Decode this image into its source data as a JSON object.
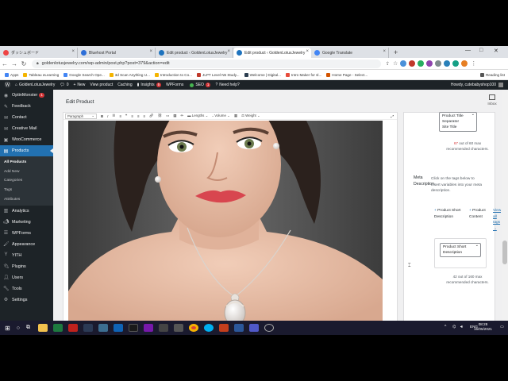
{
  "browser": {
    "tabs": [
      {
        "label": "ダッシュボード",
        "active": false
      },
      {
        "label": "Bluehost Portal",
        "active": false
      },
      {
        "label": "Edit product ‹ GoldenLotusJewelry",
        "active": false
      },
      {
        "label": "Edit product ‹ GoldenLotusJewelry",
        "active": true
      },
      {
        "label": "Google Translate",
        "active": false
      }
    ],
    "new_tab": "+",
    "url": "goldenlotusjewelry.com/wp-admin/post.php?post=379&action=edit",
    "bookmarks": [
      "Apps",
      "Tableau eLearning",
      "Google Search Ope...",
      "3d Scan Anything U...",
      "Introduction to Co...",
      "JLPT Level N5 Study...",
      "Welcome | Digital...",
      "Intro Maker for sl...",
      "Home Page - Select..."
    ],
    "reading_list": "Reading list"
  },
  "adminbar": {
    "site": "GoldenLotusJewelry",
    "comments": "0",
    "new": "New",
    "view": "View product",
    "caching": "Caching",
    "insights": "Insights",
    "insights_count": "5",
    "wpforms": "WPForms",
    "seo": "SEO",
    "seo_count": "1",
    "help": "Need help?",
    "howdy": "Howdy, cutebabyshop100"
  },
  "sidebar": {
    "items": [
      {
        "label": "OptinMonster",
        "badge": "1",
        "icon": "optinmonster-icon"
      },
      {
        "label": "Feedback",
        "icon": "feedback-icon"
      },
      {
        "label": "Contact",
        "icon": "contact-icon"
      },
      {
        "label": "Creative Mail",
        "icon": "mail-icon"
      },
      {
        "label": "WooCommerce",
        "icon": "woocommerce-icon"
      },
      {
        "label": "Products",
        "icon": "products-icon",
        "active": true
      }
    ],
    "submenu": [
      "All Products",
      "Add New",
      "Categories",
      "Tags",
      "Attributes"
    ],
    "items_after": [
      {
        "label": "Analytics",
        "icon": "analytics-icon"
      },
      {
        "label": "Marketing",
        "icon": "marketing-icon"
      },
      {
        "label": "WPForms",
        "icon": "wpforms-icon"
      },
      {
        "label": "Appearance",
        "icon": "appearance-icon"
      },
      {
        "label": "YITH",
        "icon": "yith-icon"
      },
      {
        "label": "Plugins",
        "icon": "plugins-icon"
      },
      {
        "label": "Users",
        "icon": "users-icon"
      },
      {
        "label": "Tools",
        "icon": "tools-icon"
      },
      {
        "label": "Settings",
        "icon": "settings-icon"
      }
    ]
  },
  "main": {
    "page_title": "Edit Product",
    "inbox": "Inbox",
    "toolbar": {
      "format": "Paragraph",
      "lengths": "Lengths",
      "volume": "Volume",
      "weight": "Weight"
    }
  },
  "seo_panel": {
    "title_tags": [
      "Product Title",
      "Separator",
      "Site Title"
    ],
    "title_count": "67",
    "title_count_text": "out of 60 max recommended characters.",
    "meta_label": "Meta Description",
    "meta_hint": "Click on the tags below to insert variables into your meta description.",
    "meta_tags": [
      "Product Short Description",
      "Product Content"
    ],
    "view_all": "View all tags →",
    "meta_selected": "Product Short Description",
    "meta_count": "42",
    "meta_count_text": "out of 160 max recommended characters."
  },
  "taskbar": {
    "time": "08:28",
    "date": "15/05/2021",
    "lang": "ENG"
  },
  "colors": {
    "wp_dark": "#1d2327",
    "wp_blue": "#2271b1",
    "alert_red": "#d63638"
  }
}
